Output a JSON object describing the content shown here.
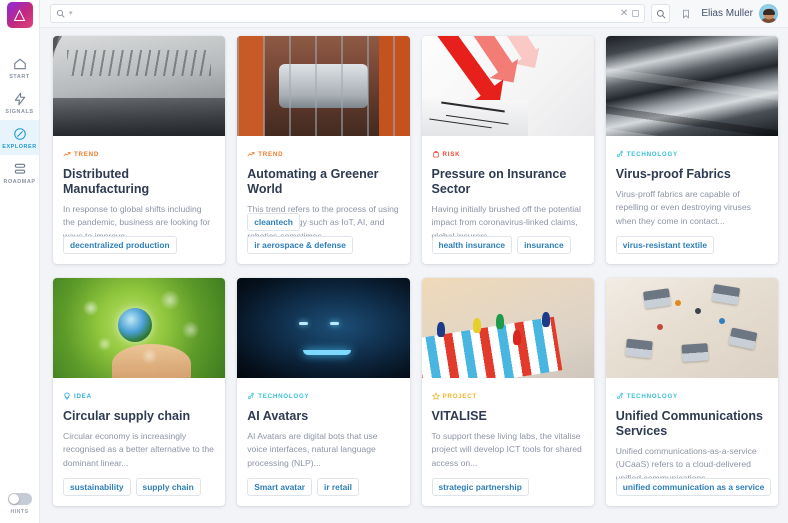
{
  "sidebar": {
    "logo_name": "app-logo",
    "items": [
      {
        "label": "START",
        "icon": "home-icon",
        "active": false
      },
      {
        "label": "SIGNALS",
        "icon": "lightning-icon",
        "active": false
      },
      {
        "label": "EXPLORER",
        "icon": "compass-icon",
        "active": true
      },
      {
        "label": "ROADMAP",
        "icon": "layers-icon",
        "active": false
      }
    ],
    "hints_label": "HINTS",
    "hints_on": false
  },
  "topbar": {
    "search_value": "",
    "search_placeholder": "",
    "search_icon": "search-icon",
    "dropdown_icon": "caret-down-icon",
    "clear_icon": "clear-x-icon",
    "expand_icon": "expand-box-icon",
    "search_button_icon": "search-icon",
    "bookmark_icon": "bookmark-icon",
    "user_name": "Elias Muller",
    "avatar_name": "user-avatar"
  },
  "badge_colors": {
    "TREND": "#ef7b28",
    "RISK": "#f04a35",
    "TECHNOLOGY": "#3ac1d8",
    "IDEA": "#35a8e0",
    "PROJECT": "#f0b429"
  },
  "cards": [
    {
      "badge": "TREND",
      "badge_icon": "trending-up-icon",
      "title": "Distributed Manufacturing",
      "description": "In response to global shifts including the pandemic, business are looking for ways to improve..",
      "tags": [
        "decentralized production"
      ],
      "image_name": "factory-machinery-photo",
      "art": "art-factory"
    },
    {
      "badge": "TREND",
      "badge_icon": "trending-up-icon",
      "title": "Automating a Greener World",
      "description": "This trend refers to the process of using new technology such as IoT, AI, and robotics-sometimes...",
      "tags": [
        "cleantech",
        "ir aerospace & defense"
      ],
      "image_name": "robotic-car-assembly-photo",
      "art": "art-robots"
    },
    {
      "badge": "RISK",
      "badge_icon": "alert-icon",
      "title": "Pressure on Insurance Sector",
      "description": "Having initially brushed off the potential impact from coronavirus-linked claims, global insurers...",
      "tags": [
        "health insurance",
        "insurance"
      ],
      "image_name": "red-down-arrow-photo",
      "art": "art-arrow"
    },
    {
      "badge": "TECHNOLOGY",
      "badge_icon": "network-node-icon",
      "title": "Virus-proof Fabrics",
      "description": "Virus-proff fabrics are capable of repelling or even destroying viruses when they come in contact...",
      "tags": [
        "virus-resistant textile"
      ],
      "image_name": "draped-fabric-photo",
      "art": "art-fabric"
    },
    {
      "badge": "IDEA",
      "badge_icon": "lightbulb-icon",
      "title": "Circular supply chain",
      "description": "Circular economy is increasingly recognised as a better alternative to the dominant linear...",
      "tags": [
        "sustainability",
        "supply chain"
      ],
      "image_name": "green-globe-bubbles-photo",
      "art": "art-green"
    },
    {
      "badge": "TECHNOLOGY",
      "badge_icon": "network-node-icon",
      "title": "AI Avatars",
      "description": "AI Avatars are digital bots that use voice interfaces, natural language processing (NLP)...",
      "tags": [
        "Smart avatar",
        "ir retail"
      ],
      "image_name": "glowing-blue-face-photo",
      "art": "art-ai"
    },
    {
      "badge": "PROJECT",
      "badge_icon": "star-icon",
      "title": "VITALISE",
      "description": "To support these living labs, the vitalise project will develop ICT tools for shared access on...",
      "tags": [
        "strategic partnership"
      ],
      "image_name": "board-game-pieces-photo",
      "art": "art-board"
    },
    {
      "badge": "TECHNOLOGY",
      "badge_icon": "network-node-icon",
      "title": "Unified Communications Services",
      "description": "Unified communications-as-a-service (UCaaS) refers to a cloud-delivered unified communications...",
      "tags": [
        "unified communication as a service"
      ],
      "image_name": "desk-laptops-overhead-photo",
      "art": "art-desk"
    }
  ]
}
